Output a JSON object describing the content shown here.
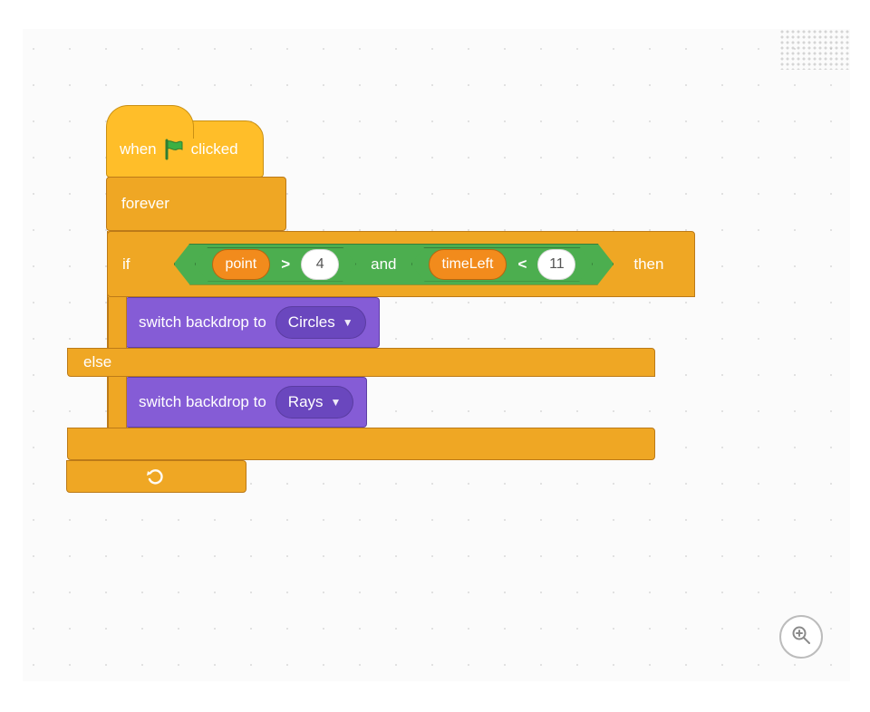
{
  "hat": {
    "when": "when",
    "clicked": "clicked",
    "icon": "green-flag"
  },
  "forever": {
    "label": "forever"
  },
  "if_block": {
    "if": "if",
    "then": "then",
    "else": "else",
    "condition": {
      "and_label": "and",
      "left": {
        "var": "point",
        "op": ">",
        "value": "4"
      },
      "right": {
        "var": "timeLeft",
        "op": "<",
        "value": "11"
      }
    }
  },
  "switch1": {
    "label": "switch backdrop to",
    "selected": "Circles"
  },
  "switch2": {
    "label": "switch backdrop to",
    "selected": "Rays"
  },
  "zoom": {
    "title": "zoom-in"
  },
  "colors": {
    "event": "#ffbe29",
    "control": "#efa724",
    "operator": "#4cae4f",
    "variable": "#f28b1c",
    "looks": "#855cd6"
  }
}
